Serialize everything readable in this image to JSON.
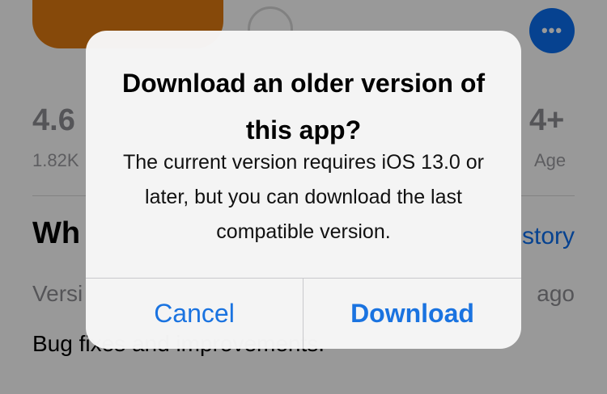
{
  "background": {
    "more_button_icon": "ellipsis-icon",
    "more_button_glyph": "•••",
    "rating_value": "4.6",
    "rating_count": "1.82K",
    "age_value": "4+",
    "age_label": "Age",
    "whats_new_title": "Wh",
    "version_history_link": "story",
    "version_label": "Versi",
    "version_date": "ago",
    "release_notes": "Bug fixes and improvements."
  },
  "alert": {
    "title": "Download an older version of this app?",
    "message": "The current version requires iOS 13.0 or later, but you can download the last compatible version.",
    "cancel_label": "Cancel",
    "download_label": "Download"
  },
  "colors": {
    "accent": "#1a73e0",
    "app_icon": "#e07a12"
  }
}
